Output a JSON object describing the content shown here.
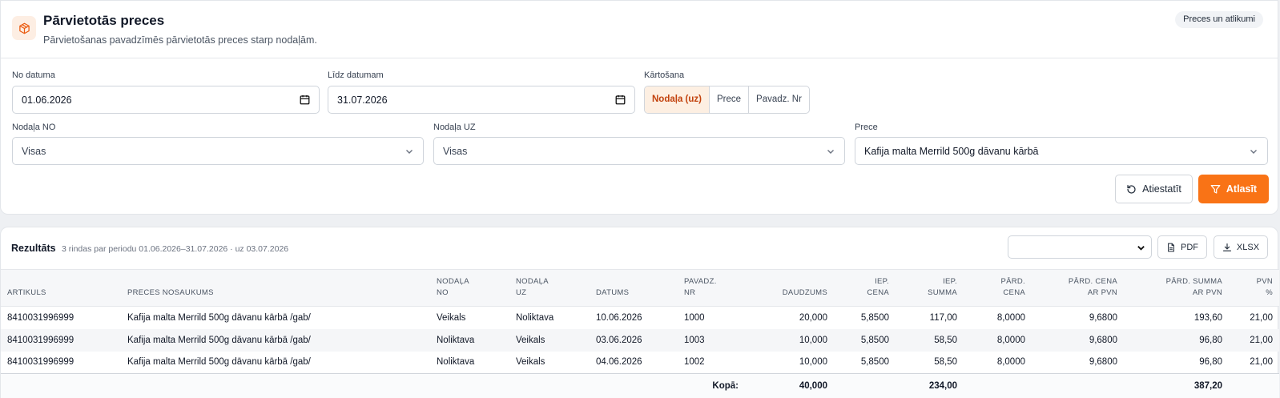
{
  "header": {
    "title": "Pārvietotās preces",
    "subtitle": "Pārvietošanas pavadzīmēs pārvietotās preces starp nodaļām.",
    "badge": "Preces un atlikumi",
    "icon": "box-icon",
    "accent": "#f97316"
  },
  "filters": {
    "from_label": "No datuma",
    "from_value": "01.06.2026",
    "to_label": "Līdz datumam",
    "to_value": "31.07.2026",
    "sort_label": "Kārtošana",
    "sort_options": [
      "Nodaļa (uz)",
      "Prece",
      "Pavadz. Nr"
    ],
    "dept_from_label": "Nodaļa NO",
    "dept_from_value": "Visas",
    "dept_to_label": "Nodaļa UZ",
    "dept_to_value": "Visas",
    "product_label": "Prece",
    "product_value": "Kafija malta Merrild 500g dāvanu kārbā",
    "reset_label": "Atiestatīt",
    "submit_label": "Atlasīt"
  },
  "results": {
    "title": "Rezultāts",
    "meta": "3 rindas par periodu 01.06.2026–31.07.2026 · uz 03.07.2026",
    "select_value": "",
    "pdf_label": "PDF",
    "xlsx_label": "XLSX",
    "columns": [
      [
        "ARTIKULS"
      ],
      [
        "PRECES NOSAUKUMS"
      ],
      [
        "NODAĻA",
        "NO"
      ],
      [
        "NODAĻA",
        "UZ"
      ],
      [
        "DATUMS"
      ],
      [
        "PAVADZ.",
        "NR"
      ],
      [
        "DAUDZUMS"
      ],
      [
        "IEP.",
        "CENA"
      ],
      [
        "IEP.",
        "SUMMA"
      ],
      [
        "PĀRD.",
        "CENA"
      ],
      [
        "PĀRD. CENA",
        "AR PVN"
      ],
      [
        "PĀRD. SUMMA",
        "AR PVN"
      ],
      [
        "PVN",
        "%"
      ]
    ],
    "rows": [
      [
        "8410031996999",
        "Kafija malta Merrild 500g dāvanu kārbā /gab/",
        "Veikals",
        "Noliktava",
        "10.06.2026",
        "1000",
        "20,000",
        "5,8500",
        "117,00",
        "8,0000",
        "9,6800",
        "193,60",
        "21,00"
      ],
      [
        "8410031996999",
        "Kafija malta Merrild 500g dāvanu kārbā /gab/",
        "Noliktava",
        "Veikals",
        "03.06.2026",
        "1003",
        "10,000",
        "5,8500",
        "58,50",
        "8,0000",
        "9,6800",
        "96,80",
        "21,00"
      ],
      [
        "8410031996999",
        "Kafija malta Merrild 500g dāvanu kārbā /gab/",
        "Noliktava",
        "Veikals",
        "04.06.2026",
        "1002",
        "10,000",
        "5,8500",
        "58,50",
        "8,0000",
        "9,6800",
        "96,80",
        "21,00"
      ]
    ],
    "totals": {
      "label": "Kopā:",
      "quantity": "40,000",
      "purchase_sum": "234,00",
      "sale_sum_vat": "387,20"
    }
  }
}
